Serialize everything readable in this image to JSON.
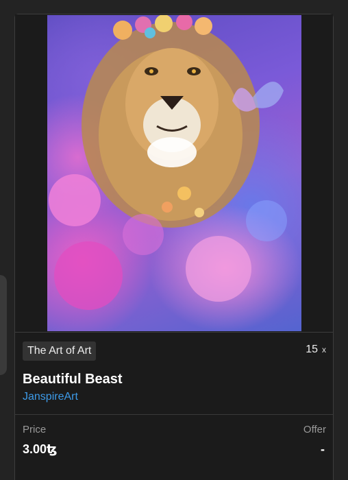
{
  "artwork": {
    "image_alt_icon": "lion-artwork-image",
    "collection": "The Art of Art",
    "edition_count": "15",
    "edition_suffix": "x",
    "title": "Beautiful Beast",
    "artist": "JanspireArt"
  },
  "pricing": {
    "price_label": "Price",
    "price_value": "3.00ꜩ",
    "offer_label": "Offer",
    "offer_value": "-"
  },
  "colors": {
    "background": "#232323",
    "card": "#1b1b1b",
    "accent_link": "#3d9be9",
    "chip": "#333333"
  }
}
